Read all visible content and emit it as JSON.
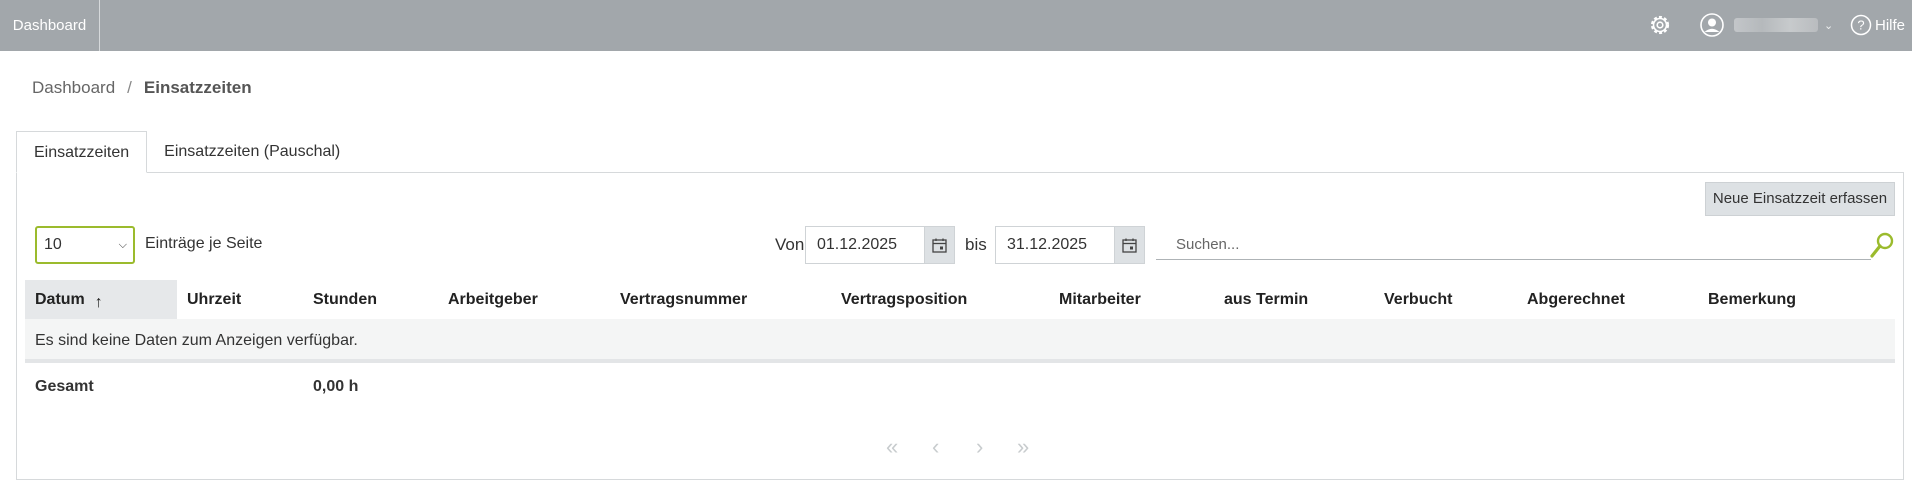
{
  "topbar": {
    "brand": "Dashboard",
    "settings_icon": "gear-icon",
    "user_icon": "user-circle-icon",
    "help_label": "Hilfe",
    "colors": {
      "bar": "#a2a7ab"
    }
  },
  "breadcrumb": {
    "items": [
      "Dashboard",
      "Einsatzzeiten"
    ],
    "separator": "/"
  },
  "tabs": [
    {
      "label": "Einsatzzeiten",
      "active": true
    },
    {
      "label": "Einsatzzeiten (Pauschal)",
      "active": false
    }
  ],
  "toolbar": {
    "new_button": "Neue Einsatzzeit erfassen",
    "page_size_value": "10",
    "page_size_label": "Einträge je Seite",
    "von_label": "Von",
    "date_from": "01.12.2025",
    "bis_label": "bis",
    "date_to": "31.12.2025",
    "search_placeholder": "Suchen..."
  },
  "table": {
    "columns": [
      "Datum",
      "Uhrzeit",
      "Stunden",
      "Arbeitgeber",
      "Vertragsnummer",
      "Vertragsposition",
      "Mitarbeiter",
      "aus Termin",
      "Verbucht",
      "Abgerechnet",
      "Bemerkung"
    ],
    "sorted_column": "Datum",
    "sort_direction": "ascending",
    "empty_message": "Es sind keine Daten zum Anzeigen verfügbar.",
    "total_label": "Gesamt",
    "total_value": "0,00 h"
  },
  "pager": {
    "first": "«",
    "prev": "‹",
    "next": "›",
    "last": "»"
  },
  "colors": {
    "accent": "#9bbb2d",
    "button_bg": "#dde1e4"
  }
}
